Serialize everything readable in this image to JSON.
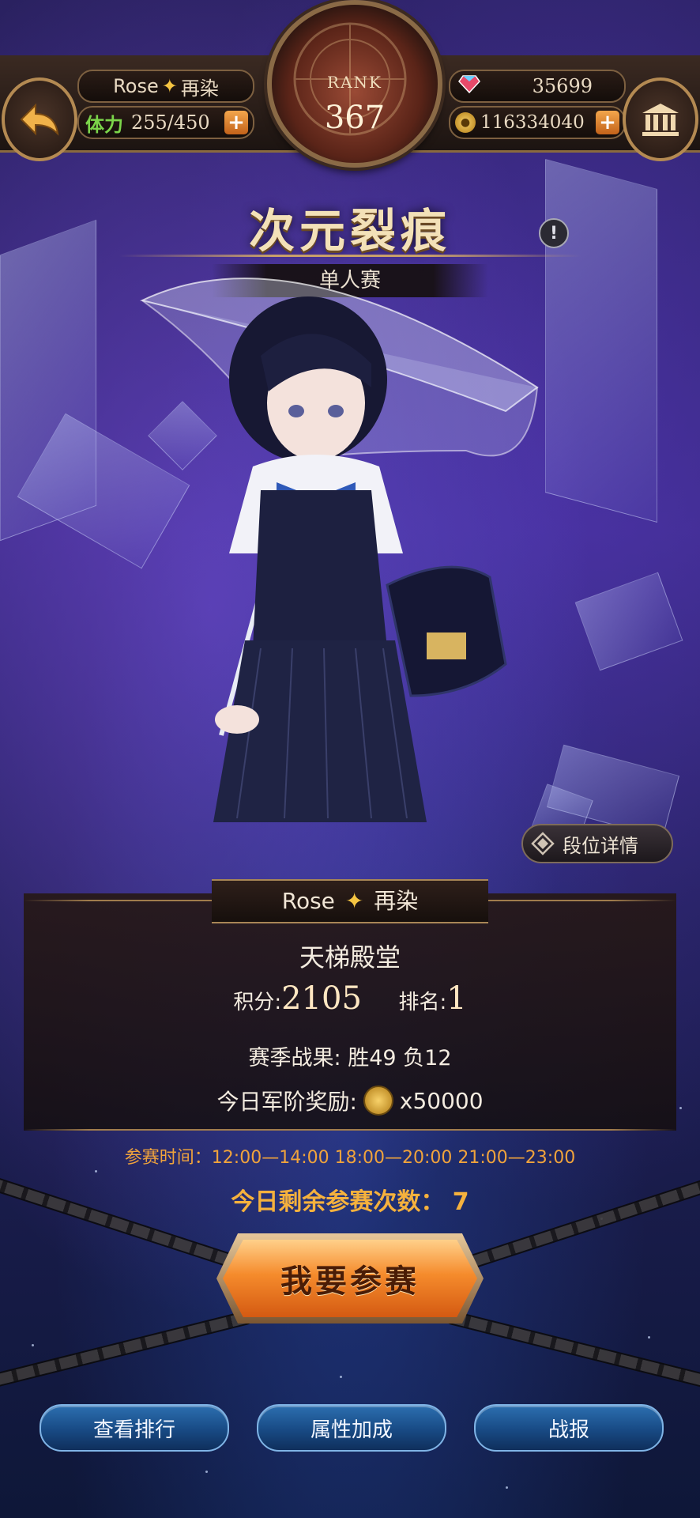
{
  "header": {
    "player_name": "Rose",
    "player_name_suffix": "再染",
    "stamina_label": "体力",
    "stamina_value": "255/450",
    "rank_label": "RANK",
    "rank_value": "367",
    "gems": "35699",
    "gold": "116334040"
  },
  "title": {
    "main": "次元裂痕",
    "subtitle": "单人赛"
  },
  "detail_button_label": "段位详情",
  "panel": {
    "player_name": "Rose",
    "player_name_suffix": "再染",
    "tier": "天梯殿堂",
    "score_label": "积分:",
    "score_value": "2105",
    "rank_label": "排名:",
    "rank_value": "1",
    "season_label": "赛季战果:",
    "season_value": "胜49 负12",
    "reward_label": "今日军阶奖励:",
    "reward_value": "x50000"
  },
  "schedule": "参赛时间：12:00—14:00 18:00—20:00 21:00—23:00",
  "remaining_label": "今日剩余参赛次数：",
  "remaining_value": "7",
  "join_button_label": "我要参赛",
  "bottom_buttons": {
    "ranking": "查看排行",
    "attributes": "属性加成",
    "battle_report": "战报"
  },
  "colors": {
    "accent_gold": "#f5b13d",
    "button_orange": "#f58b2c",
    "button_blue": "#184a84",
    "stamina_green": "#7bd44a"
  }
}
